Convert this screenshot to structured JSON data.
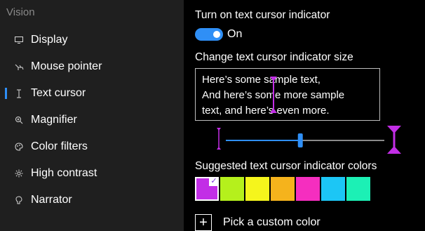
{
  "sidebar": {
    "header": "Vision",
    "items": [
      {
        "label": "Display",
        "icon": "monitor-icon"
      },
      {
        "label": "Mouse pointer",
        "icon": "mouse-pointer-icon"
      },
      {
        "label": "Text cursor",
        "icon": "text-cursor-icon",
        "active": true
      },
      {
        "label": "Magnifier",
        "icon": "magnifier-icon"
      },
      {
        "label": "Color filters",
        "icon": "color-filters-icon"
      },
      {
        "label": "High contrast",
        "icon": "high-contrast-icon"
      },
      {
        "label": "Narrator",
        "icon": "narrator-icon"
      }
    ]
  },
  "main": {
    "indicator_heading": "Turn on text cursor indicator",
    "toggle_state": "On",
    "size_heading": "Change text cursor indicator size",
    "sample_lines": [
      "Here’s some sample text,",
      "And here’s some more sample",
      "text, and here’s even more."
    ],
    "size_slider_level": 0.47,
    "colors_heading": "Suggested text cursor indicator colors",
    "swatches": [
      {
        "color": "#c22ee6",
        "selected": true
      },
      {
        "color": "#b5f01c"
      },
      {
        "color": "#f5f51c"
      },
      {
        "color": "#f5b31c"
      },
      {
        "color": "#f52ebf"
      },
      {
        "color": "#1cc6f5"
      },
      {
        "color": "#1cf0b5"
      }
    ],
    "custom_color_label": "Pick a custom color"
  },
  "colors": {
    "accent": "#2f8ff6",
    "indicator": "#c22ee6",
    "sidebar_bg": "#1f1f1f",
    "main_bg": "#000000"
  }
}
